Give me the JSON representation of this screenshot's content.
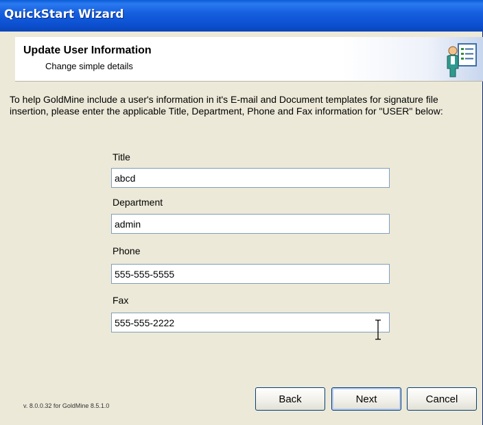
{
  "window": {
    "title": "QuickStart Wizard"
  },
  "header": {
    "title": "Update User Information",
    "subtitle": "Change simple details",
    "icon": "user-info-icon"
  },
  "intro_text": "To help GoldMine include a user's information in it's E-mail and Document templates for signature file insertion, please enter the applicable Title, Department, Phone and Fax information for \"USER\" below:",
  "fields": {
    "title": {
      "label": "Title",
      "value": "abcd"
    },
    "department": {
      "label": "Department",
      "value": "admin"
    },
    "phone": {
      "label": "Phone",
      "value": "555-555-5555"
    },
    "fax": {
      "label": "Fax",
      "value": "555-555-2222"
    }
  },
  "version_text": "v. 8.0.0.32 for GoldMine 8.5.1.0",
  "buttons": {
    "back": "Back",
    "next": "Next",
    "cancel": "Cancel"
  },
  "colors": {
    "title_bar": "#0b4fcf",
    "dialog_bg": "#ece9d8",
    "input_border": "#7f9db9",
    "button_border": "#003c74"
  }
}
